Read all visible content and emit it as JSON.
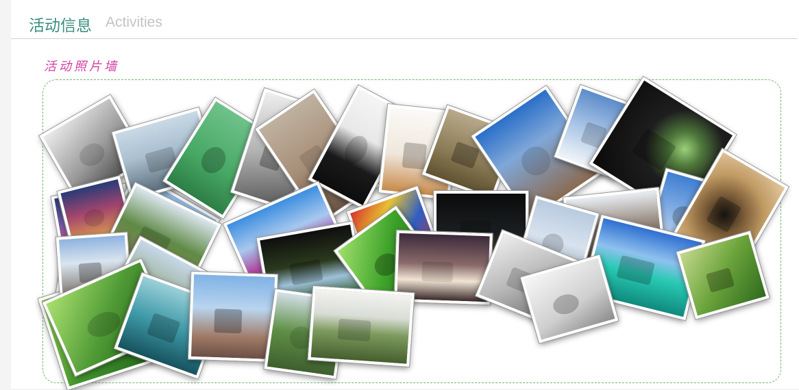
{
  "header": {
    "title_cn": "活动信息",
    "title_en": "Activities"
  },
  "gallery": {
    "label": "活动照片墙",
    "border_color": "#6fb36f",
    "photos": [
      {
        "name": "photo-bw-monument",
        "bg": "linear-gradient(160deg,#ececec 0%,#9a9a9a 55%,#3f3f3f 100%)"
      },
      {
        "name": "photo-city-lights",
        "bg": "linear-gradient(180deg,#2b3f77 0%,#7a5aa8 55%,#e14f64 100%)"
      },
      {
        "name": "photo-palace-street",
        "bg": "linear-gradient(180deg,#dfe6ee 0%,#c8c2b8 50%,#6e6a60 100%)"
      },
      {
        "name": "photo-green-leaves",
        "bg": "linear-gradient(135deg,#8fd04c 0%,#3e8f2b 55%,#1e5a17 100%)"
      },
      {
        "name": "photo-leaning-grass",
        "bg": "linear-gradient(180deg,#8fb5e0 0%,#a3bf78 45%,#8a6e3d 100%)"
      },
      {
        "name": "photo-harbor-skyline",
        "bg": "linear-gradient(180deg,#c9d9e6 0%,#a9bfcf 45%,#5d6f7c 100%)"
      },
      {
        "name": "photo-turtle-pool",
        "bg": "linear-gradient(180deg,#6ec28a 0%,#47a865 60%,#2d7e45 100%)"
      },
      {
        "name": "photo-palm-bw",
        "bg": "linear-gradient(160deg,#f0f0f0 0%,#b3b3b3 50%,#565656 100%)"
      },
      {
        "name": "photo-great-wall",
        "bg": "linear-gradient(180deg,#bfb1a0 0%,#a88f79 50%,#6b5645 100%)"
      },
      {
        "name": "photo-silhouette",
        "bg": "linear-gradient(180deg,#f5f5f5 0%,#e8e8e8 40%,#1a1a1a 70%,#0d0d0d 100%)"
      },
      {
        "name": "photo-orange-dog",
        "bg": "linear-gradient(180deg,#fbfaf7 0%,#efe7dc 55%,#c88a4a 100%)"
      },
      {
        "name": "photo-two-dogs",
        "bg": "linear-gradient(180deg,#b7a98a 0%,#8a7a55 60%,#5f5232 100%)"
      },
      {
        "name": "photo-arch-ruins",
        "bg": "linear-gradient(180deg,#2b6fc9 0%,#7fa7d8 40%,#8b6b52 100%)"
      },
      {
        "name": "photo-clouds",
        "bg": "linear-gradient(180deg,#5d8cc9 0%,#a8c4e6 50%,#f0f4f8 100%)"
      },
      {
        "name": "photo-cave",
        "bg": "radial-gradient(circle at 68% 38%,#9bd07a 0%,#4f7a3b 18%,#1e1e1e 42%,#0a0a0a 100%)"
      },
      {
        "name": "photo-purple-tree",
        "bg": "linear-gradient(180deg,#3d8ee0 0%,#a8c8ee 40%,#b04aa0 70%,#6d2f63 100%)"
      },
      {
        "name": "photo-balloon",
        "bg": "linear-gradient(135deg,#d6342b 0%,#e7c233 30%,#2f5ec2 60%,#d6342b 100%)"
      },
      {
        "name": "photo-night-street",
        "bg": "linear-gradient(180deg,#0b0b0b 0%,#1b1f22 60%,#6a5a2e 100%)"
      },
      {
        "name": "photo-eiffel",
        "bg": "linear-gradient(180deg,#3f7fd2 0%,#8fb6e6 60%,#c9d8ea 100%)"
      },
      {
        "name": "photo-spiral",
        "bg": "radial-gradient(circle at 45% 55%,#1f1a14 0%,#7b5c38 30%,#c09a63 60%,#e3c9a0 100%)"
      },
      {
        "name": "photo-old-tower",
        "bg": "linear-gradient(180deg,#e9edf2 0%,#8e7f74 50%,#4a3f37 100%)"
      },
      {
        "name": "photo-pier",
        "bg": "linear-gradient(180deg,#b9cbe0 0%,#d7e2ee 50%,#8e9dab 100%)"
      },
      {
        "name": "photo-tropical-sea",
        "bg": "linear-gradient(180deg,#2f6fd1 0%,#8fc1ee 35%,#28c9b3 60%,#0f8a7d 100%)"
      },
      {
        "name": "photo-cucumbers",
        "bg": "linear-gradient(135deg,#c4d98c 0%,#6aa33a 50%,#2f6a1e 100%)"
      },
      {
        "name": "photo-carnival",
        "bg": "linear-gradient(180deg,#283b78 0%,#a3456e 45%,#e3a64a 100%)"
      },
      {
        "name": "photo-hill-path",
        "bg": "linear-gradient(180deg,#dbe6ef 0%,#5f8a45 45%,#9c8363 100%)"
      },
      {
        "name": "photo-night-tree",
        "bg": "linear-gradient(180deg,#0e0e0e 0%,#2b3a1e 45%,#9ec1d9 70%,#2f5a2c 100%)"
      },
      {
        "name": "photo-ladybug-leaf",
        "bg": "linear-gradient(135deg,#9fe06a 0%,#3ea22a 50%,#1b6a14 100%)"
      },
      {
        "name": "photo-fish-cat",
        "bg": "linear-gradient(180deg,#3b2a3a 0%,#8a6a6a 45%,#f0e4d4 70%,#3a2a2a 100%)"
      },
      {
        "name": "photo-tiles-spider",
        "bg": "linear-gradient(135deg,#eeeeee 0%,#b8b8b8 50%,#6a6a6a 100%)"
      },
      {
        "name": "photo-white-fence",
        "bg": "linear-gradient(160deg,#f7f7f7 0%,#cfcfcf 60%,#8c8c8c 100%)"
      },
      {
        "name": "photo-big-ben",
        "bg": "linear-gradient(180deg,#8fb3df 0%,#d9e4ef 40%,#6f6258 100%)"
      },
      {
        "name": "photo-wall-road",
        "bg": "linear-gradient(180deg,#c6d8ea 0%,#9fb29a 50%,#6d6d66 100%)"
      },
      {
        "name": "photo-green-branch",
        "bg": "linear-gradient(135deg,#a9e06f 0%,#4f9a35 50%,#1d5a15 100%)"
      },
      {
        "name": "photo-teal-sea",
        "bg": "linear-gradient(180deg,#9bd0d9 0%,#3f9aa8 50%,#16535e 100%)"
      },
      {
        "name": "photo-plaza-crowd",
        "bg": "linear-gradient(180deg,#7fb2e6 0%,#b9d4ee 40%,#a07a66 75%,#6b4f45 100%)"
      },
      {
        "name": "photo-bushes",
        "bg": "linear-gradient(180deg,#d3dfe6 0%,#5f8f46 50%,#3e5f2e 100%)"
      },
      {
        "name": "photo-valley",
        "bg": "linear-gradient(180deg,#f3f3f0 0%,#d9ddd6 35%,#7d9a5e 60%,#455f2e 100%)"
      }
    ]
  }
}
